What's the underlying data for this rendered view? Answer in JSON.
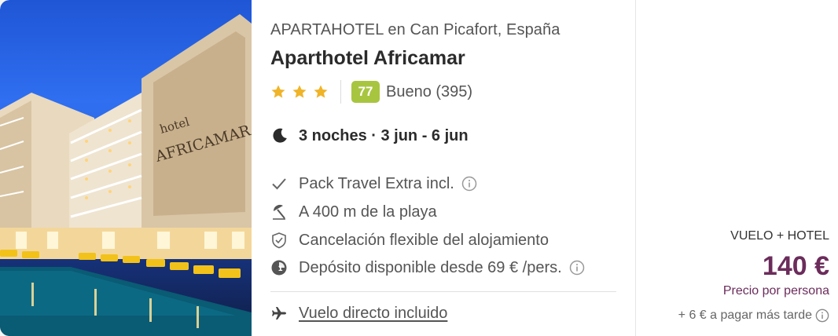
{
  "hotel": {
    "subtitle": "APARTAHOTEL en Can Picafort, España",
    "name": "Aparthotel Africamar",
    "stars": 3,
    "score": "77",
    "score_text": "Bueno (395)",
    "sign_text_top": "hotel",
    "sign_text_main": "AFRICAMAR"
  },
  "stay": {
    "text": "3 noches · 3 jun - 6 jun",
    "icon": "moon-icon"
  },
  "features": [
    {
      "icon": "check-icon",
      "label": "Pack Travel Extra incl.",
      "has_info": true
    },
    {
      "icon": "beach-umbrella-icon",
      "label": "A 400 m de la playa",
      "has_info": false
    },
    {
      "icon": "shield-check-icon",
      "label": "Cancelación flexible del alojamiento",
      "has_info": false
    },
    {
      "icon": "deposit-icon",
      "label": "Depósito disponible desde 69 € /pers.",
      "has_info": true
    }
  ],
  "flight": {
    "icon": "plane-icon",
    "label": "Vuelo directo incluido"
  },
  "price": {
    "package_label": "VUELO + HOTEL",
    "amount": "140 €",
    "per_person": "Precio por persona",
    "later": "+ 6 € a pagar más tarde"
  },
  "colors": {
    "accent": "#6b2c5b",
    "score_badge": "#a8c540",
    "star": "#f0b429"
  }
}
